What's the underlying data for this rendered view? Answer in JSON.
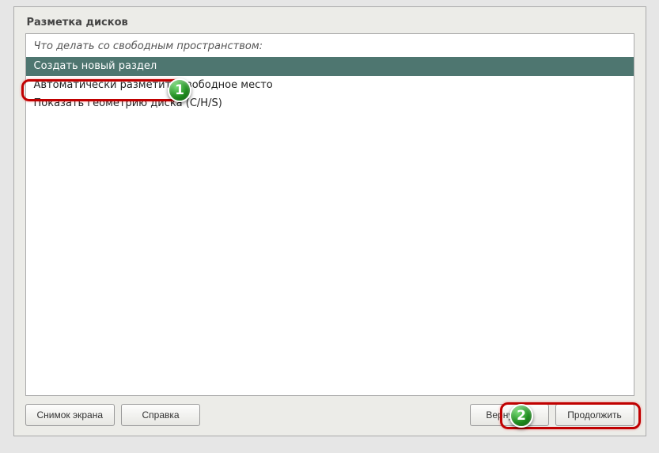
{
  "window_title": "Разметка дисков",
  "prompt": "Что делать со свободным пространством:",
  "options": [
    {
      "label": "Создать новый раздел",
      "selected": true
    },
    {
      "label": "Автоматически разметить свободное место",
      "selected": false
    },
    {
      "label": "Показать геометрию диска (C/H/S)",
      "selected": false
    }
  ],
  "buttons": {
    "screenshot": "Снимок экрана",
    "help": "Справка",
    "back": "Вернуться",
    "continue": "Продолжить"
  },
  "callouts": {
    "c1": "1",
    "c2": "2"
  }
}
